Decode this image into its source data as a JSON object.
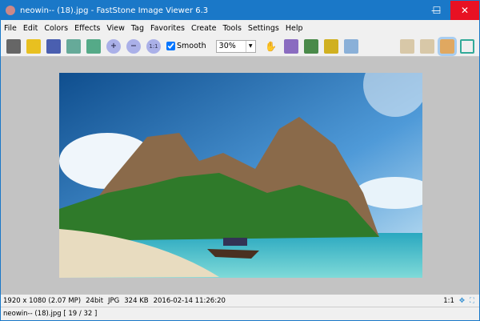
{
  "window": {
    "title": "neowin-- (18).jpg  -  FastStone Image Viewer 6.3",
    "minimize": "—",
    "maximize": "☐",
    "close": "✕"
  },
  "menu": [
    "File",
    "Edit",
    "Colors",
    "Effects",
    "View",
    "Tag",
    "Favorites",
    "Create",
    "Tools",
    "Settings",
    "Help"
  ],
  "toolbar": {
    "smooth_label": "Smooth",
    "smooth_checked": true,
    "zoom_value": "30%"
  },
  "status": {
    "dimensions": "1920 x 1080 (2.07 MP)",
    "bitdepth": "24bit",
    "format": "JPG",
    "size": "324 KB",
    "datetime": "2016-02-14 11:26:20",
    "ratio": "1:1"
  },
  "footer": {
    "file": "neowin-- (18).jpg [ 19 / 32 ]"
  },
  "colors": {
    "titlebar": "#1a78c8",
    "close": "#e81123",
    "background": "#c3c3c3"
  }
}
